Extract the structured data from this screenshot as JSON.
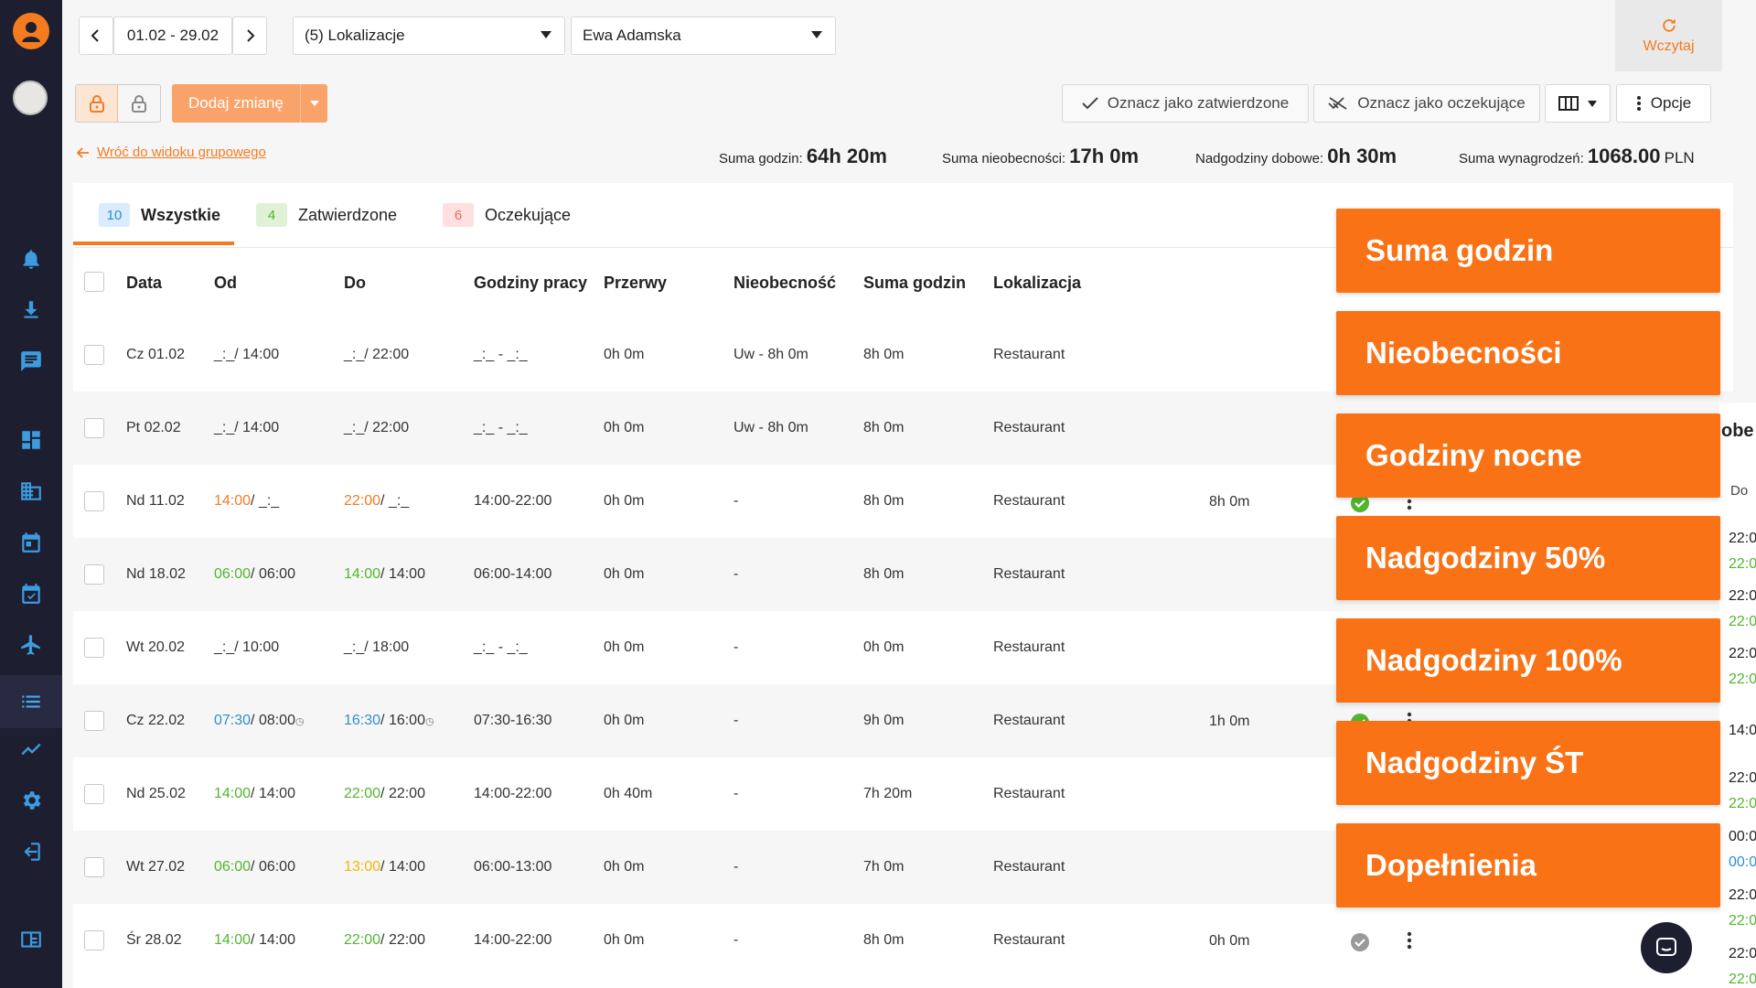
{
  "toolbar": {
    "date_range": "01.02 - 29.02",
    "locations": "(5) Lokalizacje",
    "employee": "Ewa Adamska",
    "reload": "Wczytaj",
    "add_shift": "Dodaj zmianę",
    "mark_approved": "Oznacz jako zatwierdzone",
    "mark_pending": "Oznacz jako oczekujące",
    "options": "Opcje",
    "back_link": "Wróć do widoku grupowego"
  },
  "summary": {
    "hours_label": "Suma godzin:",
    "hours_value": "64h 20m",
    "absence_label": "Suma nieobecności:",
    "absence_value": "17h 0m",
    "overtime_label": "Nadgodziny dobowe:",
    "overtime_value": "0h 30m",
    "salary_label": "Suma wynagrodzeń:",
    "salary_value": "1068.00",
    "salary_unit": "PLN"
  },
  "tabs": [
    {
      "count": "10",
      "label": "Wszystkie"
    },
    {
      "count": "4",
      "label": "Zatwierdzone"
    },
    {
      "count": "6",
      "label": "Oczekujące"
    }
  ],
  "columns": [
    "Data",
    "Od",
    "Do",
    "Godziny pracy",
    "Przerwy",
    "Nieobecność",
    "Suma godzin",
    "Lokalizacja"
  ],
  "rows": [
    {
      "date": "Cz 01.02",
      "from_a": "_:_",
      "from_b": "/ 14:00",
      "to_a": "_:_",
      "to_b": "/ 22:00",
      "work": "_:_ - _:_",
      "breaks": "0h 0m",
      "absence": "Uw - 8h 0m",
      "total": "8h 0m",
      "loc": "Restaurant"
    },
    {
      "date": "Pt 02.02",
      "from_a": "_:_",
      "from_b": "/ 14:00",
      "to_a": "_:_",
      "to_b": "/ 22:00",
      "work": "_:_ - _:_",
      "breaks": "0h 0m",
      "absence": "Uw - 8h 0m",
      "total": "8h 0m",
      "loc": "Restaurant"
    },
    {
      "date": "Nd 11.02",
      "from_a": "14:00",
      "from_b": "/ _:_",
      "to_a": "22:00",
      "to_b": "/ _:_",
      "work": "14:00-22:00",
      "breaks": "0h 0m",
      "absence": "-",
      "total": "8h 0m",
      "loc": "Restaurant"
    },
    {
      "date": "Nd 18.02",
      "from_a": "06:00",
      "from_b": "/ 06:00",
      "to_a": "14:00",
      "to_b": "/ 14:00",
      "work": "06:00-14:00",
      "breaks": "0h 0m",
      "absence": "-",
      "total": "8h 0m",
      "loc": "Restaurant"
    },
    {
      "date": "Wt 20.02",
      "from_a": "_:_",
      "from_b": "/ 10:00",
      "to_a": "_:_",
      "to_b": "/ 18:00",
      "work": "_:_ - _:_",
      "breaks": "0h 0m",
      "absence": "-",
      "total": "0h 0m",
      "loc": "Restaurant"
    },
    {
      "date": "Cz 22.02",
      "from_a": "07:30",
      "from_b": "/ 08:00",
      "to_a": "16:30",
      "to_b": "/ 16:00",
      "work": "07:30-16:30",
      "breaks": "0h 0m",
      "absence": "-",
      "total": "9h 0m",
      "loc": "Restaurant"
    },
    {
      "date": "Nd 25.02",
      "from_a": "14:00",
      "from_b": "/ 14:00",
      "to_a": "22:00",
      "to_b": "/ 22:00",
      "work": "14:00-22:00",
      "breaks": "0h 40m",
      "absence": "-",
      "total": "7h 20m",
      "loc": "Restaurant"
    },
    {
      "date": "Wt 27.02",
      "from_a": "06:00",
      "from_b": "/ 06:00",
      "to_a": "13:00",
      "to_b": "/ 14:00",
      "work": "06:00-13:00",
      "breaks": "0h 0m",
      "absence": "-",
      "total": "7h 0m",
      "loc": "Restaurant"
    },
    {
      "date": "Śr 28.02",
      "from_a": "14:00",
      "from_b": "/ 14:00",
      "to_a": "22:00",
      "to_b": "/ 22:00",
      "work": "14:00-22:00",
      "breaks": "0h 0m",
      "absence": "-",
      "total": "8h 0m",
      "loc": "Restaurant"
    }
  ],
  "extra_cells": {
    "row3_hours": "8h 0m",
    "row6_hours": "1h 0m",
    "row9_hours": "0h 0m"
  },
  "promo": [
    "Suma godzin",
    "Nieobecności",
    "Godziny nocne",
    "Nadgodziny 50%",
    "Nadgodziny 100%",
    "Nadgodziny ŚT",
    "Dopełnienia"
  ],
  "side_peek": {
    "header": "obe",
    "sub": "Do",
    "values": [
      "22:0",
      "22:0",
      "22:0",
      "22:0",
      "22:0",
      "22:0",
      "14:0",
      "22:0",
      "22:0",
      "00:0",
      "00:0",
      "22:0",
      "22:0",
      "22:0",
      "22:0"
    ]
  },
  "colors": {
    "accent": "#f47b20",
    "sidebar": "#1d1f30",
    "icon": "#3d9bdf",
    "promo": "#f97316"
  }
}
